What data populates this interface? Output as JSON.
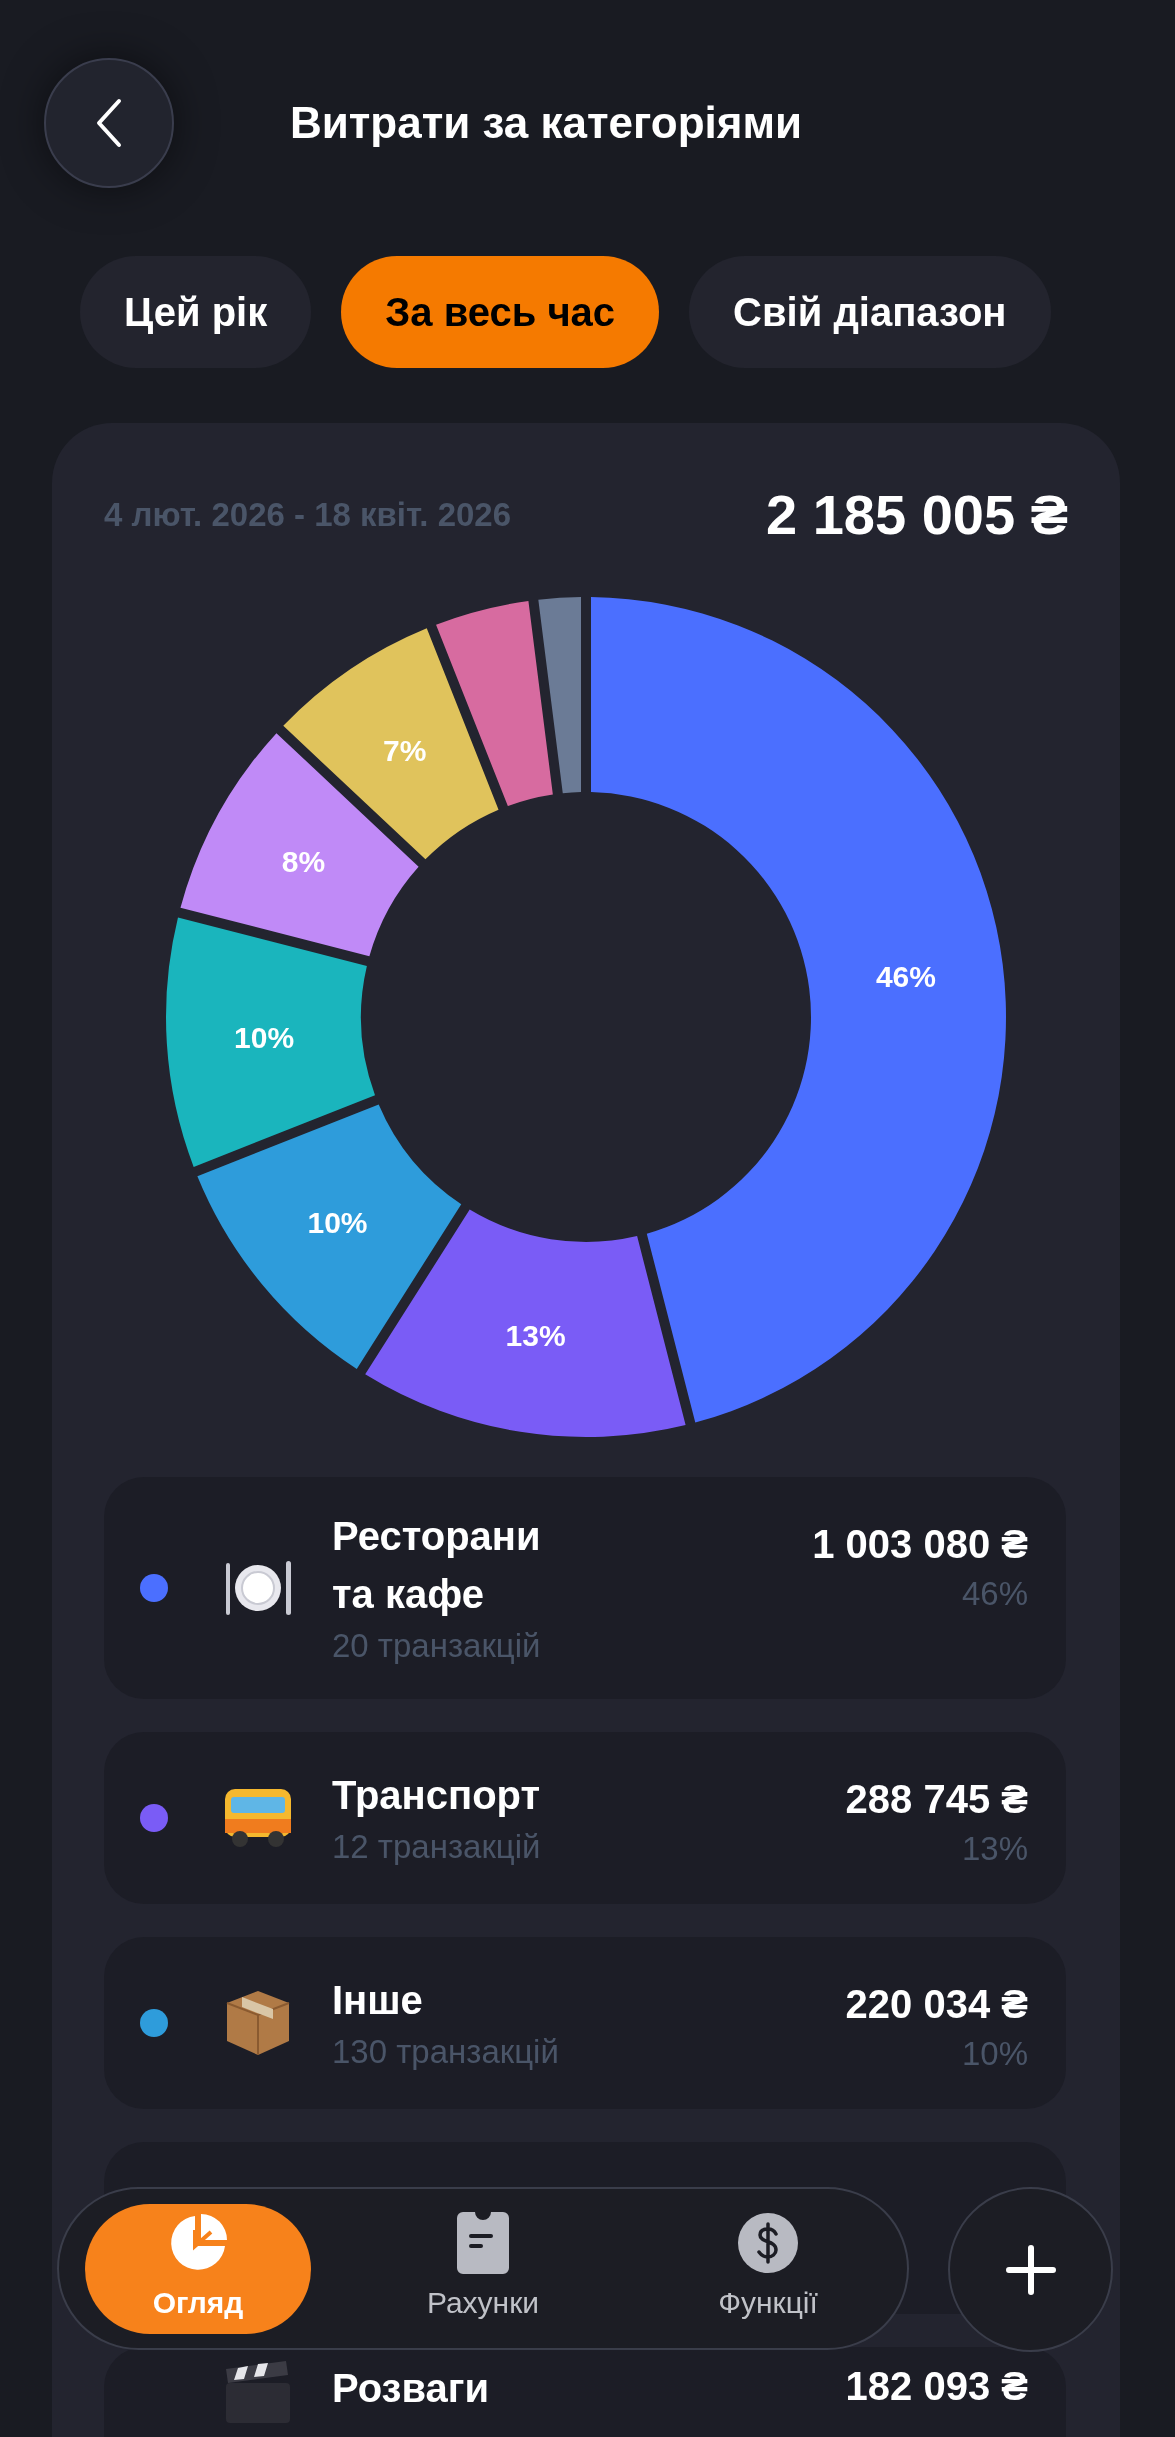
{
  "header": {
    "title": "Витрати за категоріями"
  },
  "tabs": [
    {
      "label": "Цей рік",
      "selected": false
    },
    {
      "label": "За весь час",
      "selected": true
    },
    {
      "label": "Свій діапазон",
      "selected": false
    }
  ],
  "summary": {
    "period": "4 лют. 2026 - 18 квіт. 2026",
    "total": "2 185 005 ₴"
  },
  "chart_data": {
    "type": "donut",
    "values": [
      46,
      13,
      10,
      10,
      8,
      7,
      4,
      2
    ],
    "colors": [
      "#4b6fff",
      "#7a5cf6",
      "#2e9cdb",
      "#1ab5bd",
      "#c08af7",
      "#e0c35c",
      "#d76ba0",
      "#6b7b96"
    ],
    "value_labels": [
      "46%",
      "13%",
      "10%",
      "10%",
      "8%",
      "7%",
      null,
      null
    ]
  },
  "categories": [
    {
      "name": "Ресторани та кафе",
      "count": "20 транзакцій",
      "amount": "1 003 080 ₴",
      "share": "46%",
      "color": "#4b6fff"
    },
    {
      "name": "Транспорт",
      "count": "12 транзакцій",
      "amount": "288 745 ₴",
      "share": "13%",
      "color": "#7a5cf6"
    },
    {
      "name": "Інше",
      "count": "130 транзакцій",
      "amount": "220 034 ₴",
      "share": "10%",
      "color": "#2e9cdb"
    },
    {
      "obscured": true
    },
    {
      "name": "Розваги",
      "amount": "182 093 ₴"
    }
  ],
  "nav": {
    "items": [
      {
        "label": "Огляд",
        "selected": true
      },
      {
        "label": "Рахунки",
        "selected": false
      },
      {
        "label": "Функції",
        "selected": false
      }
    ]
  }
}
